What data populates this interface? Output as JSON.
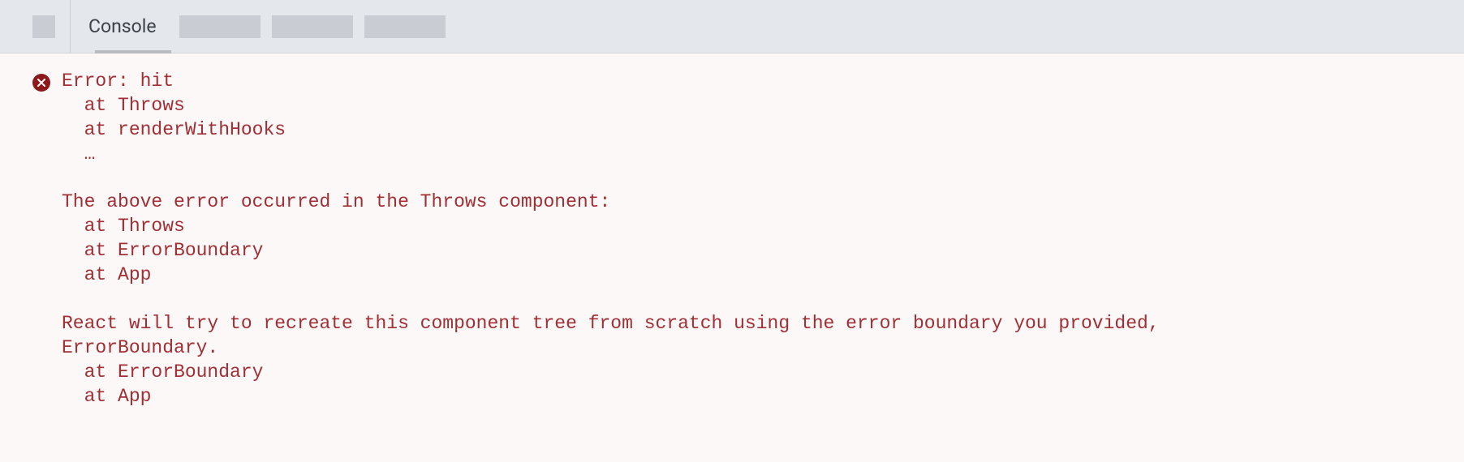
{
  "toolbar": {
    "tab_label": "Console"
  },
  "console": {
    "error_text": "Error: hit\n  at Throws\n  at renderWithHooks\n  …\n\nThe above error occurred in the Throws component:\n  at Throws\n  at ErrorBoundary\n  at App\n\nReact will try to recreate this component tree from scratch using the error boundary you provided,\nErrorBoundary.\n  at ErrorBoundary\n  at App"
  }
}
